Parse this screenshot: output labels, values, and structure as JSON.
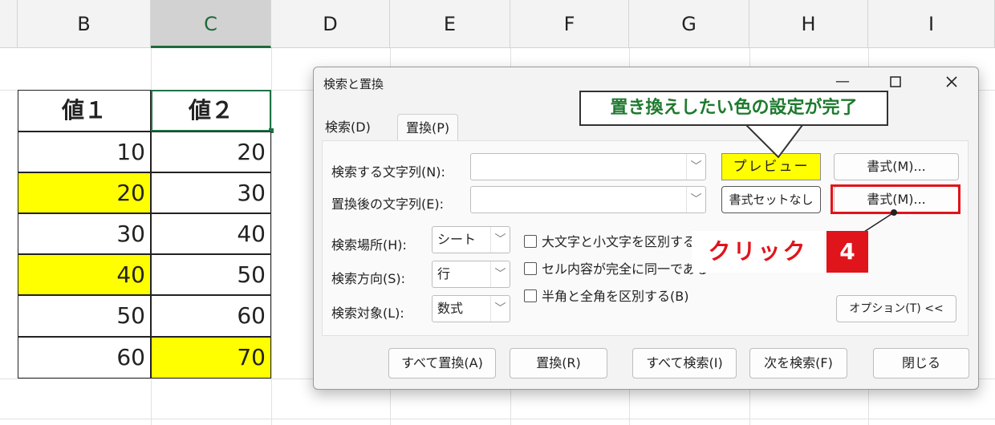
{
  "columns": [
    "B",
    "C",
    "D",
    "E",
    "F",
    "G",
    "H",
    "I"
  ],
  "table": {
    "headers": [
      "値１",
      "値２"
    ],
    "rows": [
      {
        "b": "10",
        "c": "20"
      },
      {
        "b": "20",
        "c": "30"
      },
      {
        "b": "30",
        "c": "40"
      },
      {
        "b": "40",
        "c": "50"
      },
      {
        "b": "50",
        "c": "60"
      },
      {
        "b": "60",
        "c": "70"
      }
    ],
    "highlight_color": "#ffff00"
  },
  "dialog": {
    "title": "検索と置換",
    "tabs": [
      "検索(D)",
      "置換(P)"
    ],
    "find_label": "検索する文字列(N):",
    "replace_label": "置換後の文字列(E):",
    "preview_text": "プレビュー",
    "no_format_text": "書式セットなし",
    "format_button": "書式(M)...",
    "within_label": "検索場所(H):",
    "within_value": "シート",
    "search_label": "検索方向(S):",
    "search_value": "行",
    "lookin_label": "検索対象(L):",
    "lookin_value": "数式",
    "match_case": "大文字と小文字を区別する",
    "match_entire": "セル内容が完全に同一である",
    "match_width": "半角と全角を区別する(B)",
    "options_button": "オプション(T) <<",
    "buttons": {
      "replace_all": "すべて置換(A)",
      "replace": "置換(R)",
      "find_all": "すべて検索(I)",
      "find_next": "次を検索(F)",
      "close": "閉じる"
    }
  },
  "annotations": {
    "callout": "置き換えしたい色の設定が完了",
    "click": "クリック",
    "step": "4"
  }
}
